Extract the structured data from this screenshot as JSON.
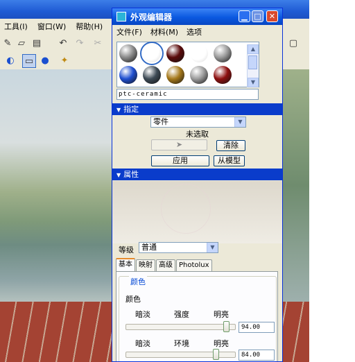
{
  "background_app": {
    "menu": [
      {
        "label": "工具(I)"
      },
      {
        "label": "窗口(W)"
      },
      {
        "label": "帮助(H)"
      }
    ],
    "right_tools": {
      "plus": "+",
      "minus": "−"
    }
  },
  "editor": {
    "title": "外观编辑器",
    "window_buttons": {
      "minimize": "▁",
      "maximize": "□",
      "close": "✕"
    },
    "menu": [
      {
        "label": "文件(F)"
      },
      {
        "label": "材料(M)"
      },
      {
        "label": "选项"
      }
    ],
    "swatches": [
      {
        "color": "#8a8a8a"
      },
      {
        "color": "#ffffff",
        "selected": true
      },
      {
        "color": "#5a0a0a"
      },
      {
        "color": "#ffffff"
      },
      {
        "color": "#9a9a9a"
      },
      {
        "color": "#1f4fd0"
      },
      {
        "color": "#3d4a55"
      },
      {
        "color": "#a5781a"
      },
      {
        "color": "#9b9b9b"
      },
      {
        "color": "#8d0f0f"
      }
    ],
    "material_name": "ptc-ceramic",
    "assign_section": {
      "header": "指定",
      "part_select": "零件",
      "status": "未选取",
      "clear_button": "清除",
      "apply_button": "应用",
      "from_model_button": "从模型"
    },
    "properties_section": {
      "header": "属性"
    },
    "class": {
      "label": "等级",
      "value": "普通"
    },
    "tabs": [
      {
        "label": "基本",
        "active": true
      },
      {
        "label": "映射"
      },
      {
        "label": "高级"
      },
      {
        "label": "Photolux"
      }
    ],
    "color_group": {
      "title": "颜色",
      "color_label": "颜色",
      "intensity": {
        "dark": "暗淡",
        "name": "强度",
        "bright": "明亮",
        "value": "94.00",
        "level": 0.94
      },
      "ambient": {
        "dark": "暗淡",
        "name": "环境",
        "bright": "明亮",
        "value": "84.00",
        "level": 0.84
      }
    }
  },
  "colors": {
    "title_bar": "#0a58e0",
    "section_bar": "#0a3ccb",
    "dialog_bg": "#ece9d8"
  }
}
